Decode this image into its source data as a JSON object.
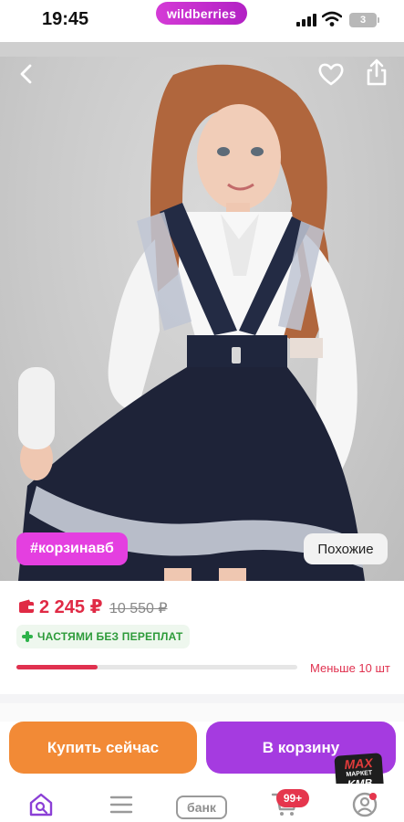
{
  "status_bar": {
    "time": "19:45",
    "battery": "3"
  },
  "header": {
    "brand": "wildberries"
  },
  "product": {
    "tag": "#корзинавб",
    "similar_label": "Похожие",
    "image_icon": "product-photo-schoolgirl-pinafore-dress"
  },
  "price": {
    "current": "2 245 ₽",
    "old": "10 550 ₽",
    "installments": "ЧАСТЯМИ БЕЗ ПЕРЕПЛАТ",
    "stock_label": "Меньше 10 шт",
    "stock_level": 0.29
  },
  "actions": {
    "buy_now": "Купить сейчас",
    "to_cart": "В корзину"
  },
  "overlay_badge": {
    "line1": "MAX",
    "line2": "МАРКЕТ",
    "line3": "KMB"
  },
  "bottom_nav": {
    "bank_label": "банк",
    "cart_count": "99+",
    "icons": [
      "home-search-icon",
      "menu-icon",
      "bank-icon",
      "cart-icon",
      "profile-icon"
    ]
  },
  "colors": {
    "brand": "#b221c4",
    "price": "#e02a45",
    "buy_now": "#f28a36",
    "to_cart": "#a53be0",
    "installments": "#2d9b3a"
  }
}
